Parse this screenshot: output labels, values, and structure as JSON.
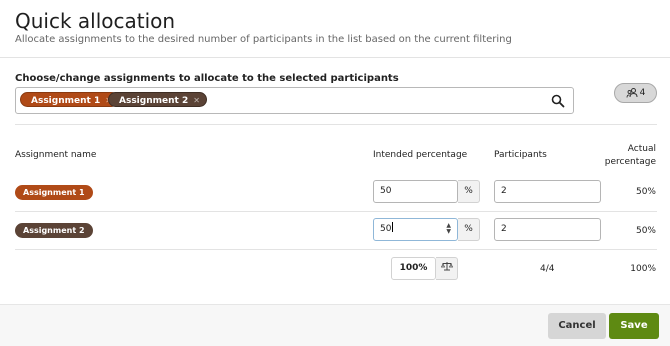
{
  "header": {
    "title": "Quick allocation",
    "subtitle": "Allocate assignments to the desired number of participants in the list based on the current filtering"
  },
  "selector": {
    "label": "Choose/change assignments to allocate to the selected participants",
    "chips": [
      {
        "label": "Assignment 1",
        "remove": "✕",
        "color": "#b04a17"
      },
      {
        "label": "Assignment 2",
        "remove": "✕",
        "color": "#5b4336"
      }
    ],
    "participant_count_label": "4"
  },
  "table": {
    "headers": {
      "name": "Assignment name",
      "intended": "Intended percentage",
      "participants": "Participants",
      "actual_line1": "Actual",
      "actual_line2": "percentage"
    },
    "rows": [
      {
        "name": "Assignment 1",
        "color": "#b04a17",
        "intended": "50",
        "unit": "%",
        "participants": "2",
        "actual": "50%"
      },
      {
        "name": "Assignment 2",
        "color": "#5b4336",
        "intended": "50",
        "unit": "%",
        "participants": "2",
        "actual": "50%"
      }
    ],
    "totals": {
      "intended": "100%",
      "participants": "4/4",
      "actual": "100%"
    }
  },
  "footer": {
    "cancel": "Cancel",
    "save": "Save",
    "save_color": "#5e8a12"
  }
}
